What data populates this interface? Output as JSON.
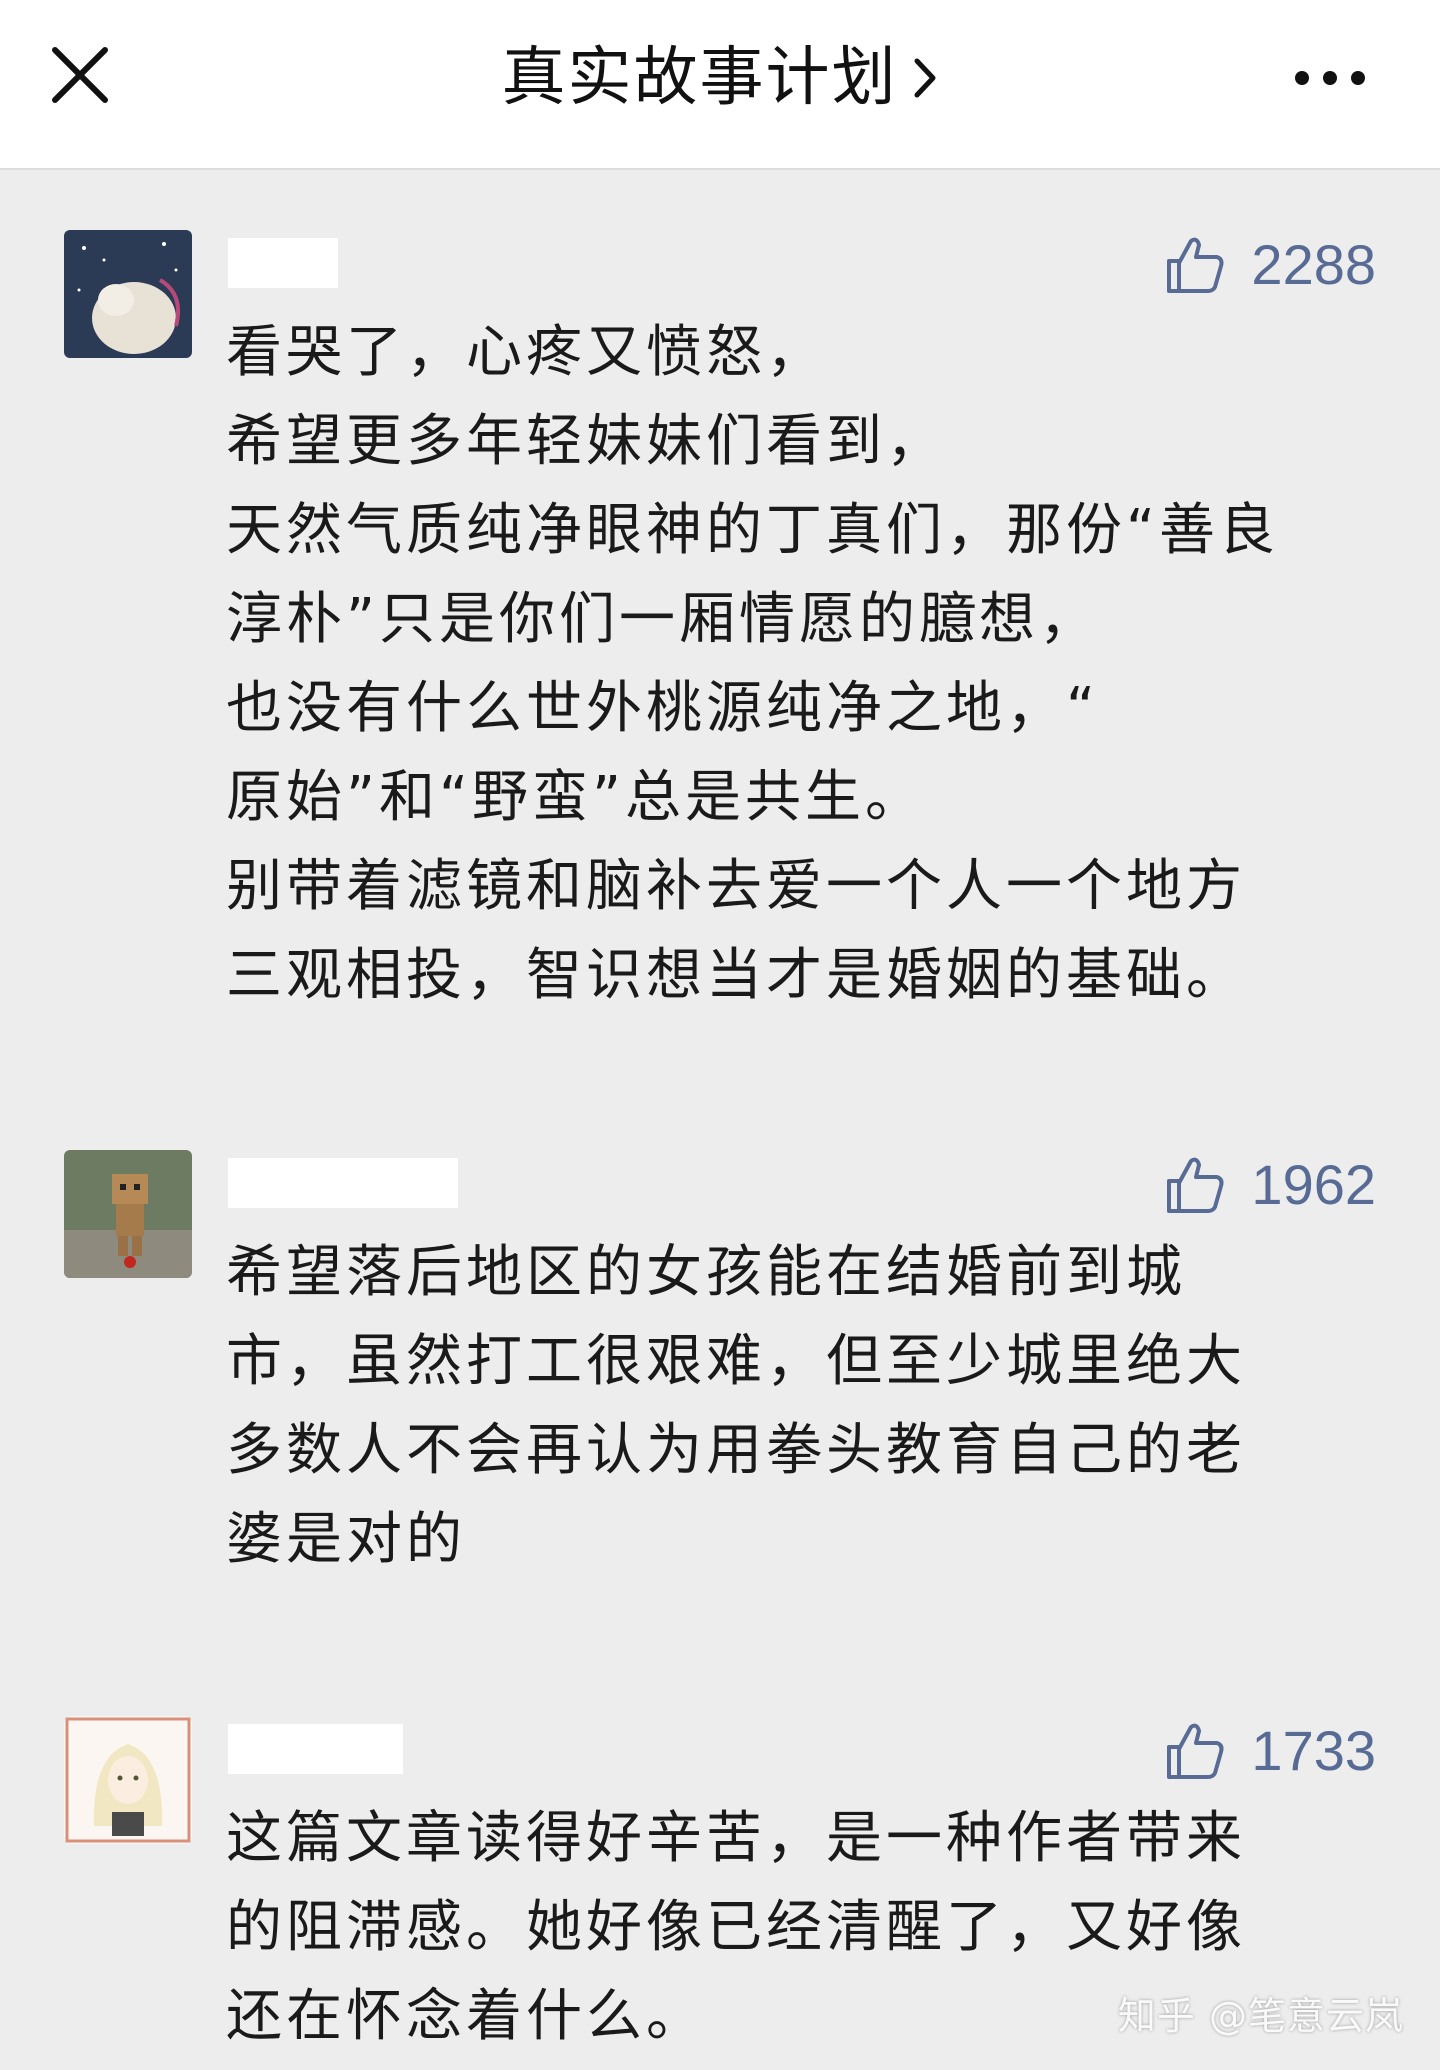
{
  "header": {
    "title": "真实故事计划",
    "close_icon": "close-icon",
    "chevron_icon": "chevron-right-icon",
    "more_icon": "more-dots-icon"
  },
  "comments": [
    {
      "likes": "2288",
      "lines": [
        "看哭了，心疼又愤怒，",
        "希望更多年轻妹妹们看到，",
        "天然气质纯净眼神的丁真们，那份“善良",
        "淳朴”只是你们一厢情愿的臆想，",
        "也没有什么世外桃源纯净之地，“",
        "原始”和“野蛮”总是共生。",
        "别带着滤镜和脑补去爱一个人一个地方",
        "三观相投，智识想当才是婚姻的基础。"
      ]
    },
    {
      "likes": "1962",
      "lines": [
        "希望落后地区的女孩能在结婚前到城",
        "市，虽然打工很艰难，但至少城里绝大",
        "多数人不会再认为用拳头教育自己的老",
        "婆是对的"
      ]
    },
    {
      "likes": "1733",
      "lines": [
        "这篇文章读得好辛苦，是一种作者带来",
        "的阻滞感。她好像已经清醒了，又好像",
        "还在怀念着什么。"
      ]
    }
  ],
  "watermark": "知乎 @笔意云岚",
  "colors": {
    "accent": "#576b95",
    "background": "#ededed",
    "text": "#1a1a1a"
  }
}
